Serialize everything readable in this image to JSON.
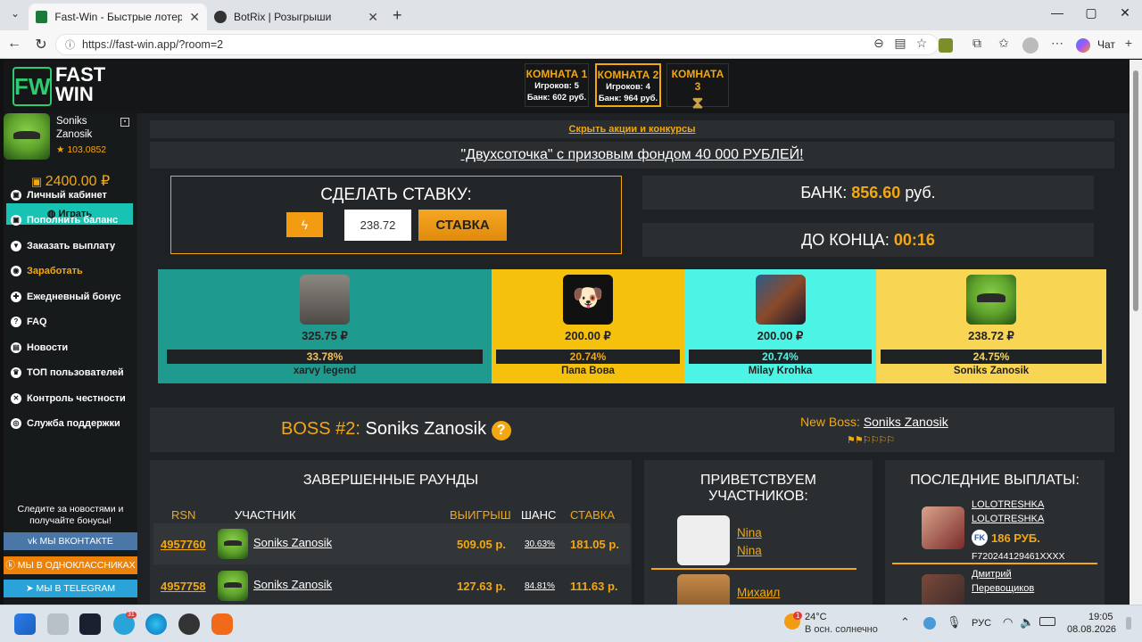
{
  "browser": {
    "tabs": [
      {
        "title": "Fast-Win - Быстрые лотереи! Ком",
        "active": true
      },
      {
        "title": "BotRix | Розыгрыши",
        "active": false
      }
    ],
    "url": "https://fast-win.app/?room=2",
    "chat_label": "Чат"
  },
  "rooms": [
    {
      "title": "КОМНАТА 1",
      "players": "Игроков: 5",
      "bank": "Банк: 602 руб."
    },
    {
      "title": "КОМНАТА 2",
      "players": "Игроков: 4",
      "bank": "Банк: 964 руб."
    },
    {
      "title": "КОМНАТА 3"
    }
  ],
  "logo": {
    "line1": "FAST",
    "line2": "WIN",
    "mark": "FW"
  },
  "user": {
    "first": "Soniks",
    "last": "Zanosik",
    "rating": "★ 103.0852",
    "balance": "2400.00 ₽"
  },
  "sidebar": {
    "play_label": "Играть",
    "items": [
      {
        "label": "Личный кабинет",
        "highlight": false
      },
      {
        "label": "Пополнить баланс",
        "highlight": false
      },
      {
        "label": "Заказать выплату",
        "highlight": false
      },
      {
        "label": "Заработать",
        "highlight": true
      },
      {
        "label": "Ежедневный бонус",
        "highlight": false
      },
      {
        "label": "FAQ",
        "highlight": false
      },
      {
        "label": "Новости",
        "highlight": false
      },
      {
        "label": "ТОП пользователей",
        "highlight": false
      },
      {
        "label": "Контроль честности",
        "highlight": false
      },
      {
        "label": "Служба поддержки",
        "highlight": false
      }
    ],
    "follow_text": "Следите за новостями и получайте бонусы!",
    "socials": [
      {
        "label": "МЫ ВКОНТАКТЕ",
        "color": "#4a76a8"
      },
      {
        "label": "МЫ В ОДНОКЛАССНИКАХ",
        "color": "#ee8208"
      },
      {
        "label": "МЫ В TELEGRAM",
        "color": "#2aa3d8"
      }
    ]
  },
  "promo": {
    "hide_label": "Скрыть акции и конкурсы",
    "banner": "\"Двухсоточка\" с призовым фондом 40 000 РУБЛЕЙ!"
  },
  "bet": {
    "title": "СДЕЛАТЬ СТАВКУ:",
    "amount": "238.72",
    "button": "СТАВКА"
  },
  "bank": {
    "label": "БАНК:",
    "value": "856.60",
    "unit": "руб."
  },
  "timer": {
    "label": "ДО КОНЦА:",
    "value": "00:16"
  },
  "players": [
    {
      "amount": "325.75 ₽",
      "chance": "33.78%",
      "name": "xarvy legend",
      "color": "#1f9a8f"
    },
    {
      "amount": "200.00 ₽",
      "chance": "20.74%",
      "name": "Папа Вова",
      "color": "#f6c10c"
    },
    {
      "amount": "200.00 ₽",
      "chance": "20.74%",
      "name": "Milay Krohka",
      "color": "#4bf4e4"
    },
    {
      "amount": "238.72 ₽",
      "chance": "24.75%",
      "name": "Soniks Zanosik",
      "color": "#f8d653"
    }
  ],
  "boss": {
    "label": "BOSS #2:",
    "name": "Soniks Zanosik",
    "help": "?",
    "new_label": "New Boss:",
    "new_name": "Soniks Zanosik"
  },
  "rounds": {
    "title": "ЗАВЕРШЕННЫЕ РАУНДЫ",
    "headers": [
      "RSN",
      "УЧАСТНИК",
      "ВЫИГРЫШ",
      "ШАНС",
      "СТАВКА"
    ],
    "rows": [
      {
        "id": "4957760",
        "name": "Soniks Zanosik",
        "win": "509.05 р.",
        "chance": "30.63%",
        "bet": "181.05 р."
      },
      {
        "id": "4957758",
        "name": "Soniks Zanosik",
        "win": "127.63 р.",
        "chance": "84.81%",
        "bet": "111.63 р."
      }
    ]
  },
  "welcome": {
    "title": "ПРИВЕТСТВУЕМ УЧАСТНИКОВ:",
    "users": [
      {
        "name1": "Nina",
        "name2": "Nina"
      },
      {
        "name1": "Михаил",
        "name2": ""
      }
    ]
  },
  "payouts": {
    "title": "ПОСЛЕДНИЕ ВЫПЛАТЫ:",
    "items": [
      {
        "name1": "LOLOTRESHKA",
        "name2": "LOLOTRESHKA",
        "amount": "186 РУБ.",
        "account": "F720244129461XXXX"
      },
      {
        "name1": "Дмитрий",
        "name2": "Перевощиков"
      }
    ]
  },
  "taskbar": {
    "weather_temp": "24°C",
    "weather_text": "В осн. солнечно",
    "lang": "РУС",
    "time": "19:05",
    "date": "08.08.2026",
    "badge": "1",
    "telegram_badge": "31"
  }
}
